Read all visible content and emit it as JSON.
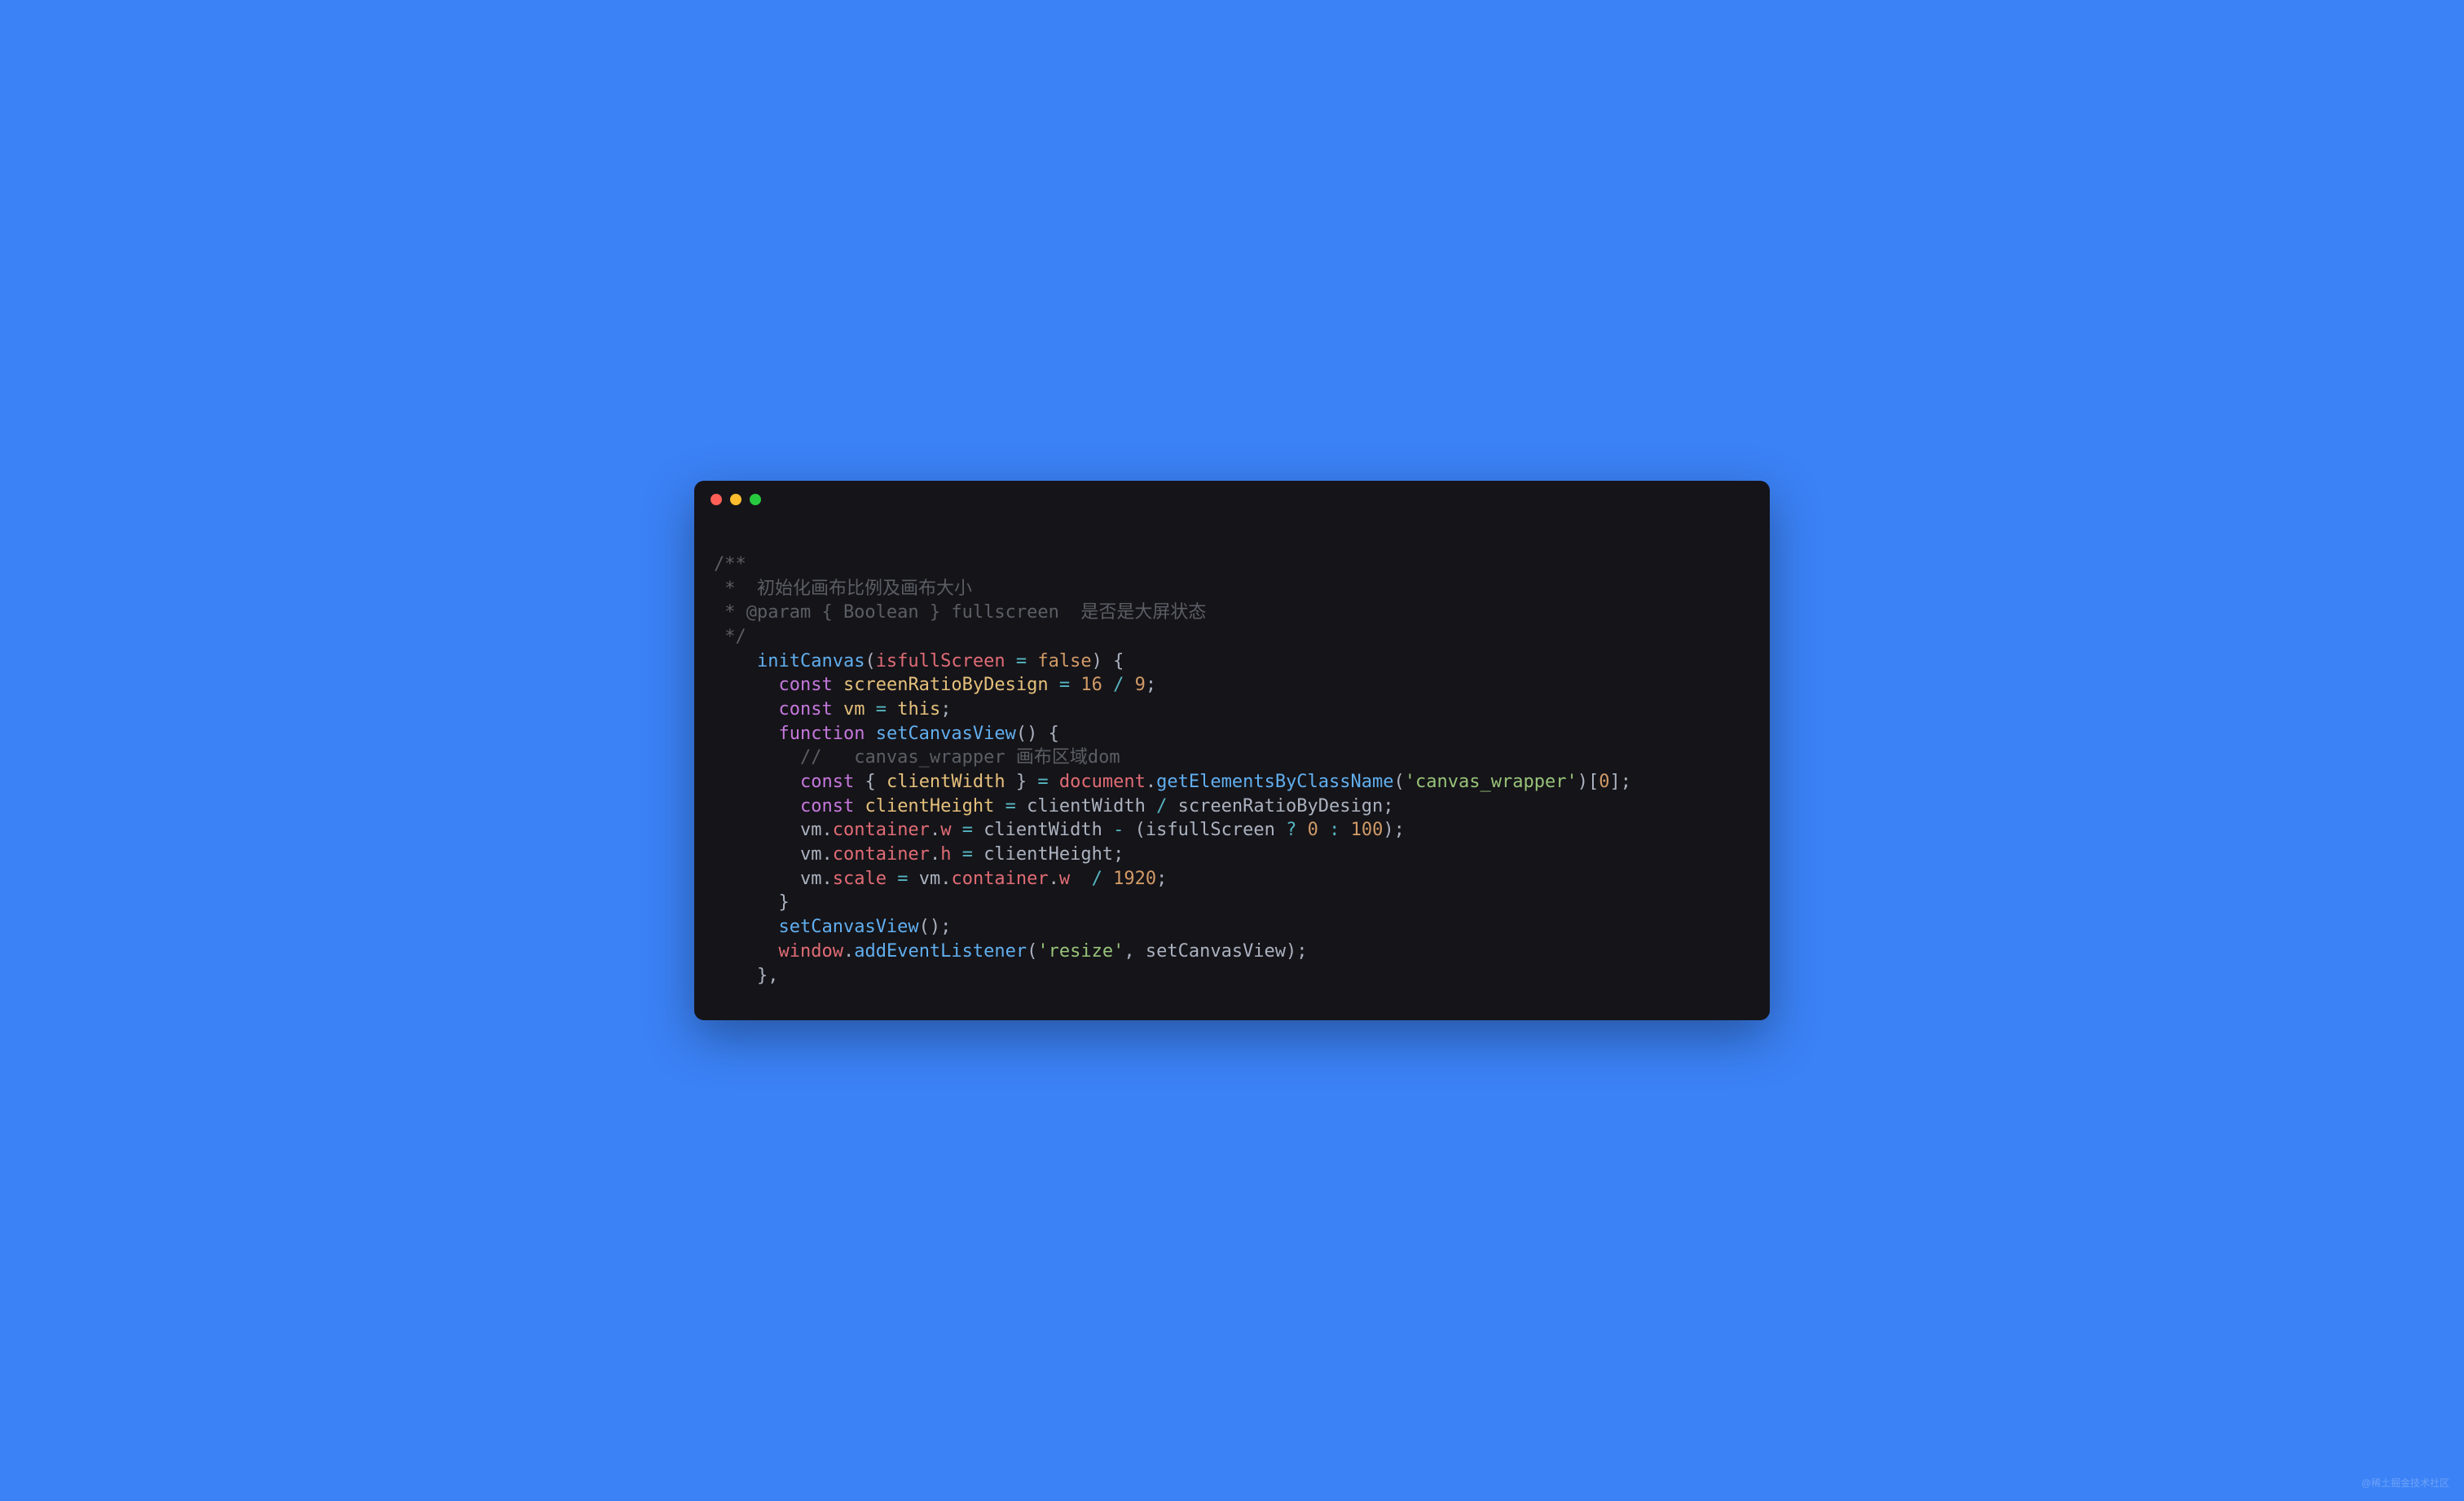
{
  "watermark": "@稀土掘金技术社区",
  "code": {
    "l1": "/**",
    "l2": " *  初始化画布比例及画布大小",
    "l3": " * @param { Boolean } fullscreen  是否是大屏状态",
    "l4": " */",
    "l5_fn": "initCanvas",
    "l5_param": "isfullScreen",
    "l5_op": "=",
    "l5_bool": "false",
    "l5_close": ") {",
    "l6_kw": "const",
    "l6_var": "screenRatioByDesign",
    "l6_eq": "=",
    "l6_n1": "16",
    "l6_div": "/",
    "l6_n2": "9",
    "l6_semi": ";",
    "l7_kw": "const",
    "l7_var": "vm",
    "l7_eq": "=",
    "l7_this": "this",
    "l7_semi": ";",
    "l8_kw": "function",
    "l8_fn": "setCanvasView",
    "l8_paren": "() {",
    "l9_comment": "//   canvas_wrapper 画布区域dom",
    "l10_kw": "const",
    "l10_open": "{ ",
    "l10_var": "clientWidth",
    "l10_close": " } ",
    "l10_eq": "=",
    "l10_doc": "document",
    "l10_dot": ".",
    "l10_method": "getElementsByClassName",
    "l10_p1": "(",
    "l10_str": "'canvas_wrapper'",
    "l10_p2": ")[",
    "l10_idx": "0",
    "l10_p3": "];",
    "l11_kw": "const",
    "l11_var": "clientHeight",
    "l11_eq": "=",
    "l11_cw": "clientWidth",
    "l11_div": "/",
    "l11_srbd": "screenRatioByDesign",
    "l11_semi": ";",
    "l12_vm": "vm",
    "l12_dot1": ".",
    "l12_cont": "container",
    "l12_dot2": ".",
    "l12_w": "w",
    "l12_eq": "=",
    "l12_cw": "clientWidth",
    "l12_minus": "-",
    "l12_p1": "(",
    "l12_ifs": "isfullScreen",
    "l12_q": "?",
    "l12_n0": "0",
    "l12_colon": ":",
    "l12_n100": "100",
    "l12_p2": ");",
    "l13_vm": "vm",
    "l13_dot1": ".",
    "l13_cont": "container",
    "l13_dot2": ".",
    "l13_h": "h",
    "l13_eq": "=",
    "l13_ch": "clientHeight",
    "l13_semi": ";",
    "l14_vm": "vm",
    "l14_dot1": ".",
    "l14_scale": "scale",
    "l14_eq": "=",
    "l14_vm2": "vm",
    "l14_dot2": ".",
    "l14_cont": "container",
    "l14_dot3": ".",
    "l14_w": "w",
    "l14_div": "/",
    "l14_n": "1920",
    "l14_semi": ";",
    "l15": "}",
    "l16_fn": "setCanvasView",
    "l16_paren": "();",
    "l17_win": "window",
    "l17_dot": ".",
    "l17_method": "addEventListener",
    "l17_p1": "(",
    "l17_str": "'resize'",
    "l17_comma": ", ",
    "l17_cb": "setCanvasView",
    "l17_p2": ");",
    "l18": "},"
  }
}
